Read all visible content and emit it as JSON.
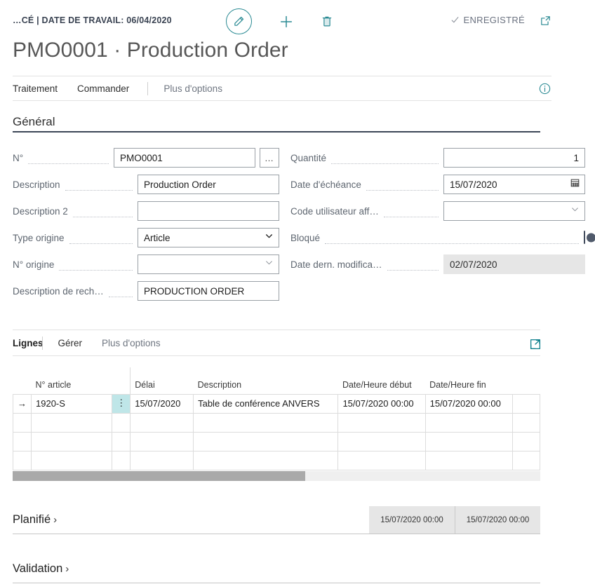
{
  "header": {
    "company_date": "…CÉ | DATE DE TRAVAIL: 06/04/2020",
    "saved_label": "ENREGISTRÉ",
    "title": "PMO0001 · Production Order",
    "icons": {
      "edit": "pencil-icon",
      "new": "plus-icon",
      "delete": "trash-icon",
      "saved_check": "check-icon",
      "open_new_window": "open-in-new-window-icon"
    },
    "accent_color": "#2a8a93",
    "title_color": "#575757"
  },
  "actionbar": {
    "items": [
      {
        "label": "Traitement",
        "muted": false
      },
      {
        "label": "Commander",
        "muted": false
      },
      {
        "label": "Plus d'options",
        "muted": true
      }
    ],
    "info_icon": "info-circle-icon"
  },
  "general": {
    "section_title": "Général",
    "left_fields": [
      {
        "label": "N°",
        "value": "PMO0001",
        "type": "text",
        "has_ellipsis": true
      },
      {
        "label": "Description",
        "value": "Production Order",
        "type": "text"
      },
      {
        "label": "Description 2",
        "value": "",
        "type": "text"
      },
      {
        "label": "Type origine",
        "value": "Article",
        "type": "select"
      },
      {
        "label": "N° origine",
        "value": "",
        "type": "lookup"
      },
      {
        "label": "Description de rech…",
        "value": "PRODUCTION ORDER",
        "type": "text"
      }
    ],
    "right_fields": [
      {
        "label": "Quantité",
        "value": "1",
        "type": "number"
      },
      {
        "label": "Date d'échéance",
        "value": "15/07/2020",
        "type": "date"
      },
      {
        "label": "Code utilisateur aff…",
        "value": "",
        "type": "lookup"
      },
      {
        "label": "Bloqué",
        "value": "",
        "type": "toggle",
        "checked": false
      },
      {
        "label": "Date dern. modifica…",
        "value": "02/07/2020",
        "type": "readonly"
      }
    ]
  },
  "lines": {
    "title": "Lignes",
    "menu": [
      {
        "label": "Gérer",
        "muted": false
      },
      {
        "label": "Plus d'options",
        "muted": true
      }
    ],
    "expand_icon": "expand-lines-icon",
    "columns": [
      "N° article",
      "Délai",
      "Description",
      "Date/Heure début",
      "Date/Heure fin"
    ],
    "rows": [
      {
        "selected": true,
        "row_indicator": "→",
        "cells": {
          "article": "1920-S",
          "delai": "15/07/2020",
          "description": "Table de conférence ANVERS",
          "start": "15/07/2020 00:00",
          "end": "15/07/2020 00:00",
          "extra": ""
        }
      },
      {
        "selected": false,
        "row_indicator": "",
        "cells": {
          "article": "",
          "delai": "",
          "description": "",
          "start": "",
          "end": "",
          "extra": ""
        }
      },
      {
        "selected": false,
        "row_indicator": "",
        "cells": {
          "article": "",
          "delai": "",
          "description": "",
          "start": "",
          "end": "",
          "extra": ""
        }
      },
      {
        "selected": false,
        "row_indicator": "",
        "cells": {
          "article": "",
          "delai": "",
          "description": "",
          "start": "",
          "end": "",
          "extra": ""
        }
      }
    ],
    "scroll": {
      "thumb_percent": 55
    }
  },
  "collapsed_sections": [
    {
      "title": "Planifié",
      "carat": "›",
      "values": [
        "15/07/2020 00:00",
        "15/07/2020 00:00"
      ]
    },
    {
      "title": "Validation",
      "carat": "›",
      "values": []
    }
  ]
}
